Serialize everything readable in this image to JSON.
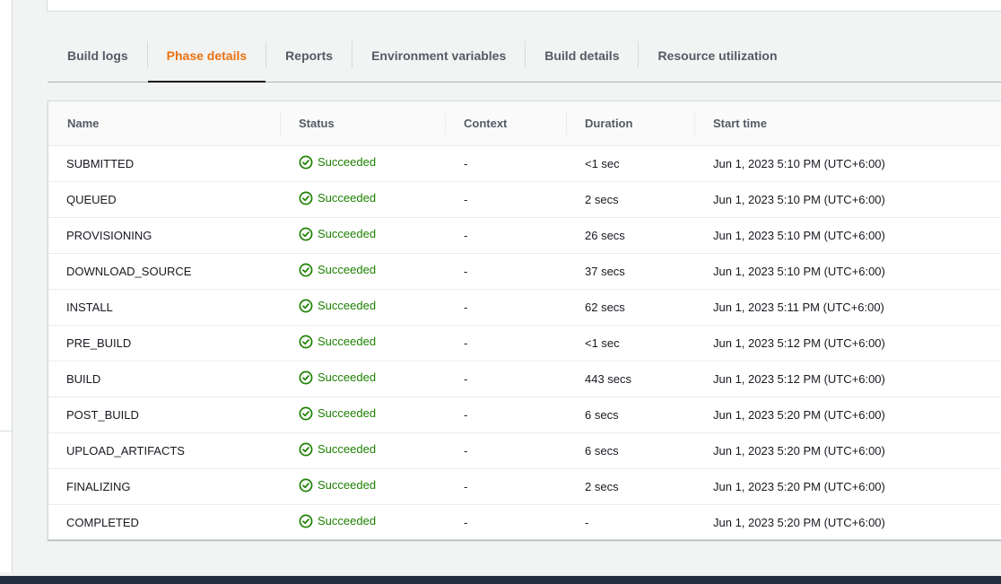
{
  "tabs": [
    {
      "label": "Build logs"
    },
    {
      "label": "Phase details"
    },
    {
      "label": "Reports"
    },
    {
      "label": "Environment variables"
    },
    {
      "label": "Build details"
    },
    {
      "label": "Resource utilization"
    }
  ],
  "active_tab": "Phase details",
  "table": {
    "columns": [
      "Name",
      "Status",
      "Context",
      "Duration",
      "Start time"
    ],
    "rows": [
      {
        "name": "SUBMITTED",
        "status": "Succeeded",
        "context": "-",
        "duration": "<1 sec",
        "start": "Jun 1, 2023 5:10 PM (UTC+6:00)"
      },
      {
        "name": "QUEUED",
        "status": "Succeeded",
        "context": "-",
        "duration": "2 secs",
        "start": "Jun 1, 2023 5:10 PM (UTC+6:00)"
      },
      {
        "name": "PROVISIONING",
        "status": "Succeeded",
        "context": "-",
        "duration": "26 secs",
        "start": "Jun 1, 2023 5:10 PM (UTC+6:00)"
      },
      {
        "name": "DOWNLOAD_SOURCE",
        "status": "Succeeded",
        "context": "-",
        "duration": "37 secs",
        "start": "Jun 1, 2023 5:10 PM (UTC+6:00)"
      },
      {
        "name": "INSTALL",
        "status": "Succeeded",
        "context": "-",
        "duration": "62 secs",
        "start": "Jun 1, 2023 5:11 PM (UTC+6:00)"
      },
      {
        "name": "PRE_BUILD",
        "status": "Succeeded",
        "context": "-",
        "duration": "<1 sec",
        "start": "Jun 1, 2023 5:12 PM (UTC+6:00)"
      },
      {
        "name": "BUILD",
        "status": "Succeeded",
        "context": "-",
        "duration": "443 secs",
        "start": "Jun 1, 2023 5:12 PM (UTC+6:00)"
      },
      {
        "name": "POST_BUILD",
        "status": "Succeeded",
        "context": "-",
        "duration": "6 secs",
        "start": "Jun 1, 2023 5:20 PM (UTC+6:00)"
      },
      {
        "name": "UPLOAD_ARTIFACTS",
        "status": "Succeeded",
        "context": "-",
        "duration": "6 secs",
        "start": "Jun 1, 2023 5:20 PM (UTC+6:00)"
      },
      {
        "name": "FINALIZING",
        "status": "Succeeded",
        "context": "-",
        "duration": "2 secs",
        "start": "Jun 1, 2023 5:20 PM (UTC+6:00)"
      },
      {
        "name": "COMPLETED",
        "status": "Succeeded",
        "context": "-",
        "duration": "-",
        "start": "Jun 1, 2023 5:20 PM (UTC+6:00)"
      }
    ]
  },
  "colors": {
    "active_tab": "#ec7211",
    "success": "#1d8102",
    "footer": "#232f3e"
  },
  "icons": {
    "status": "check-circle-icon"
  }
}
